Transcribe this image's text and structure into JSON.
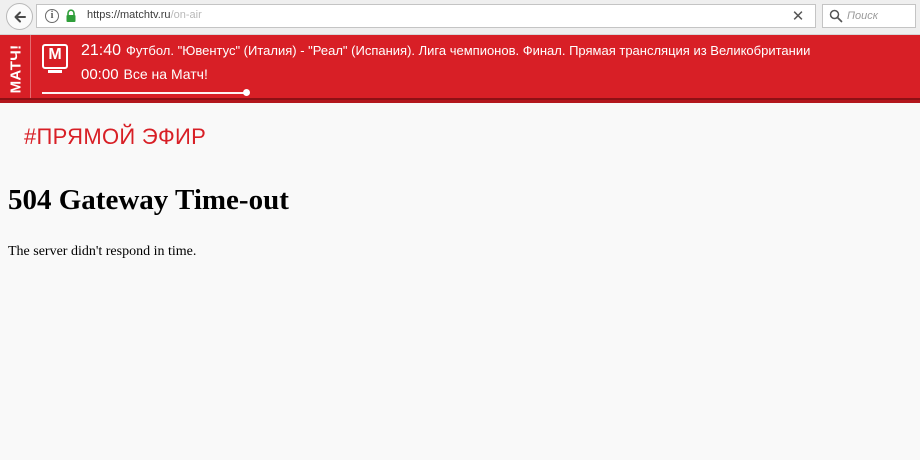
{
  "browser": {
    "url_host": "https://matchtv.ru",
    "url_path": "/on-air",
    "clear_symbol": "✕",
    "search_placeholder": "Поиск",
    "icons": [
      "back-arrow-icon",
      "info-icon",
      "lock-icon",
      "clear-icon",
      "search-icon"
    ]
  },
  "banner": {
    "vertical_logo": "МАТЧ!",
    "m_logo": "М",
    "ticker": [
      {
        "time": "21:40",
        "title": "Футбол. \"Ювентус\" (Италия) - \"Реал\" (Испания). Лига чемпионов. Финал. Прямая трансляция из Великобритании"
      },
      {
        "time": "00:00",
        "title": "Все на Матч!"
      }
    ],
    "progress_fraction": 0.96,
    "colors": {
      "background": "#d81f26",
      "accent_dark": "#8e1015",
      "text": "#ffffff"
    }
  },
  "page": {
    "live_heading": "#ПРЯМОЙ ЭФИР",
    "error_title": "504 Gateway Time-out",
    "error_message": "The server didn't respond in time."
  }
}
